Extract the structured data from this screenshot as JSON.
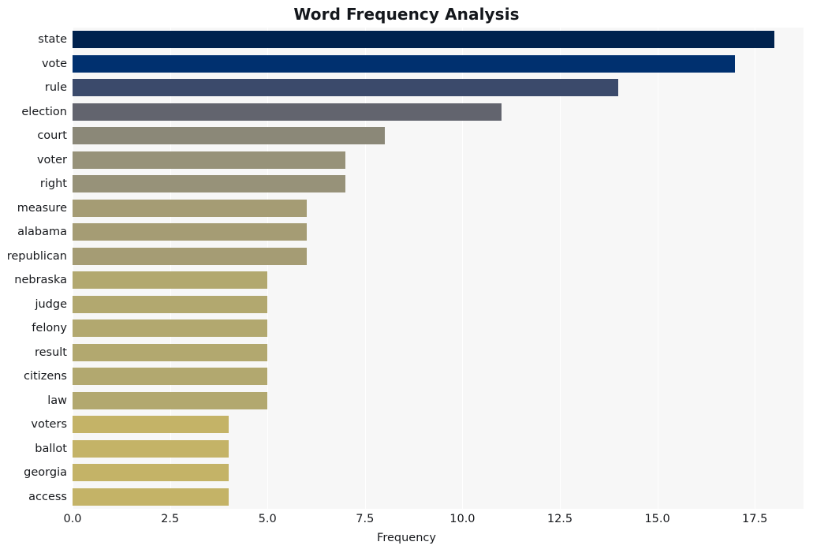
{
  "chart_data": {
    "type": "bar",
    "orientation": "horizontal",
    "title": "Word Frequency Analysis",
    "xlabel": "Frequency",
    "ylabel": "",
    "categories": [
      "state",
      "vote",
      "rule",
      "election",
      "court",
      "voter",
      "right",
      "measure",
      "alabama",
      "republican",
      "nebraska",
      "judge",
      "felony",
      "result",
      "citizens",
      "law",
      "voters",
      "ballot",
      "georgia",
      "access"
    ],
    "values": [
      18,
      17,
      14,
      11,
      8,
      7,
      7,
      6,
      6,
      6,
      5,
      5,
      5,
      5,
      5,
      5,
      4,
      4,
      4,
      4
    ],
    "bar_colors": [
      "#00224e",
      "#00306f",
      "#3b4a6b",
      "#62646e",
      "#8b8878",
      "#979279",
      "#979279",
      "#a59c74",
      "#a59c74",
      "#a59c74",
      "#b2a86f",
      "#b2a86f",
      "#b2a86f",
      "#b2a86f",
      "#b2a86f",
      "#b2a86f",
      "#c4b367",
      "#c4b367",
      "#c4b367",
      "#c4b367"
    ],
    "xlim": [
      0,
      18.75
    ],
    "xticks": [
      0.0,
      2.5,
      5.0,
      7.5,
      10.0,
      12.5,
      15.0,
      17.5
    ],
    "xtick_labels": [
      "0.0",
      "2.5",
      "5.0",
      "7.5",
      "10.0",
      "12.5",
      "15.0",
      "17.5"
    ],
    "grid": "vertical-only",
    "legend": "none",
    "colormap": "cividis",
    "plot_background": "#f7f7f7",
    "gridline_color": "#ffffff",
    "figure_background": "#ffffff"
  }
}
